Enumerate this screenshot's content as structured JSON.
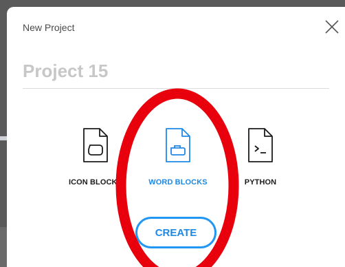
{
  "dialog": {
    "title": "New Project",
    "name_placeholder": "Project 15"
  },
  "options": [
    {
      "label": "ICON BLOCKS",
      "icon": "icon-blocks-file-icon"
    },
    {
      "label": "WORD BLOCKS",
      "icon": "word-blocks-file-icon",
      "selected": true
    },
    {
      "label": "PYTHON",
      "icon": "python-file-icon"
    }
  ],
  "create_label": "CREATE",
  "colors": {
    "accent": "#1e88e5",
    "annotation": "#e8000c",
    "overlay": "#5a5a5a"
  }
}
